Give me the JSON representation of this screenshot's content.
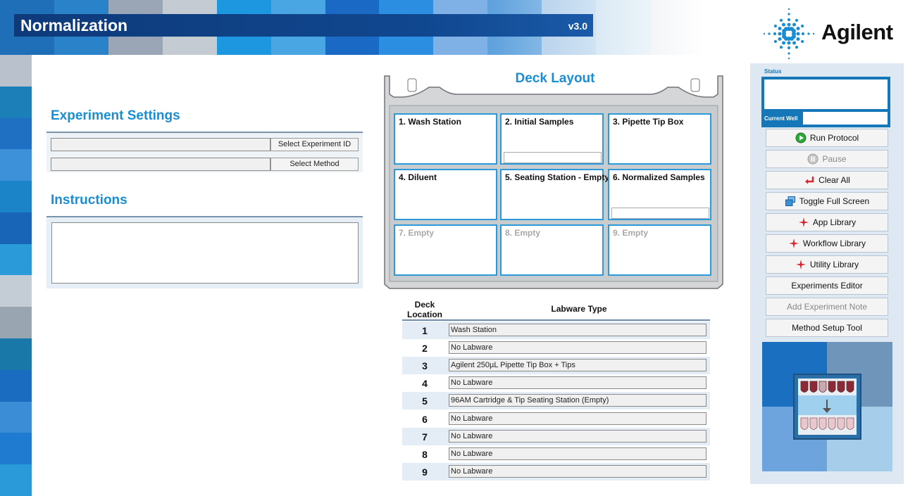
{
  "header": {
    "app_title": "Normalization",
    "version": "v3.0",
    "logo_text": "Agilent",
    "mosaic_colors": [
      "#1f6fb8",
      "#2a83c8",
      "#9aa6b5",
      "#c5cbd3",
      "#1d97e0",
      "#4aa6e3",
      "#1a69c4",
      "#2b8ee0",
      "#7fb1e6",
      "#5fa2dd",
      "#a6c8e8",
      "#b7d6ea",
      "#d2dbe3"
    ]
  },
  "experiment_settings": {
    "title": "Experiment Settings",
    "experiment_id_value": "",
    "select_experiment_id_label": "Select Experiment ID",
    "method_value": "",
    "select_method_label": "Select Method"
  },
  "instructions": {
    "title": "Instructions",
    "text": ""
  },
  "deck": {
    "title": "Deck Layout",
    "positions": [
      {
        "label": "1. Wash Station",
        "state": "occupied",
        "slot": false
      },
      {
        "label": "2. Initial Samples",
        "state": "occupied",
        "slot": true
      },
      {
        "label": "3. Pipette Tip Box",
        "state": "occupied",
        "slot": false
      },
      {
        "label": "4. Diluent",
        "state": "occupied",
        "slot": false
      },
      {
        "label": "5. Seating Station - Empty",
        "state": "occupied",
        "slot": false
      },
      {
        "label": "6. Normalized Samples",
        "state": "occupied",
        "slot": true
      },
      {
        "label": "7. Empty",
        "state": "empty",
        "slot": false
      },
      {
        "label": "8. Empty",
        "state": "empty",
        "slot": false
      },
      {
        "label": "9. Empty",
        "state": "empty",
        "slot": false
      }
    ]
  },
  "labware": {
    "header_location": "Deck\nLocation",
    "header_location_line1": "Deck",
    "header_location_line2": "Location",
    "header_type": "Labware Type",
    "rows": [
      {
        "location": "1",
        "type": "Wash Station"
      },
      {
        "location": "2",
        "type": "No Labware"
      },
      {
        "location": "3",
        "type": "Agilent 250µL Pipette Tip Box + Tips"
      },
      {
        "location": "4",
        "type": "No Labware"
      },
      {
        "location": "5",
        "type": "96AM Cartridge & Tip Seating Station (Empty)"
      },
      {
        "location": "6",
        "type": "No Labware"
      },
      {
        "location": "7",
        "type": "No Labware"
      },
      {
        "location": "8",
        "type": "No Labware"
      },
      {
        "location": "9",
        "type": "No Labware"
      }
    ]
  },
  "side_panel": {
    "status_label": "Status",
    "status_text": "",
    "current_well_label": "Current Well",
    "current_well_value": "",
    "buttons": [
      {
        "label": "Run Protocol",
        "icon": "play-icon",
        "enabled": true
      },
      {
        "label": "Pause",
        "icon": "pause-icon",
        "enabled": false
      },
      {
        "label": "Clear All",
        "icon": "undo-arrow-icon",
        "enabled": true
      },
      {
        "label": "Toggle Full Screen",
        "icon": "windows-icon",
        "enabled": true
      },
      {
        "label": "App Library",
        "icon": "sparkle-icon",
        "enabled": true
      },
      {
        "label": "Workflow Library",
        "icon": "sparkle-icon",
        "enabled": true
      },
      {
        "label": "Utility Library",
        "icon": "sparkle-icon",
        "enabled": true
      },
      {
        "label": "Experiments Editor",
        "icon": "",
        "enabled": true
      },
      {
        "label": "Add Experiment Note",
        "icon": "",
        "enabled": false
      },
      {
        "label": "Method Setup Tool",
        "icon": "",
        "enabled": true
      }
    ]
  }
}
